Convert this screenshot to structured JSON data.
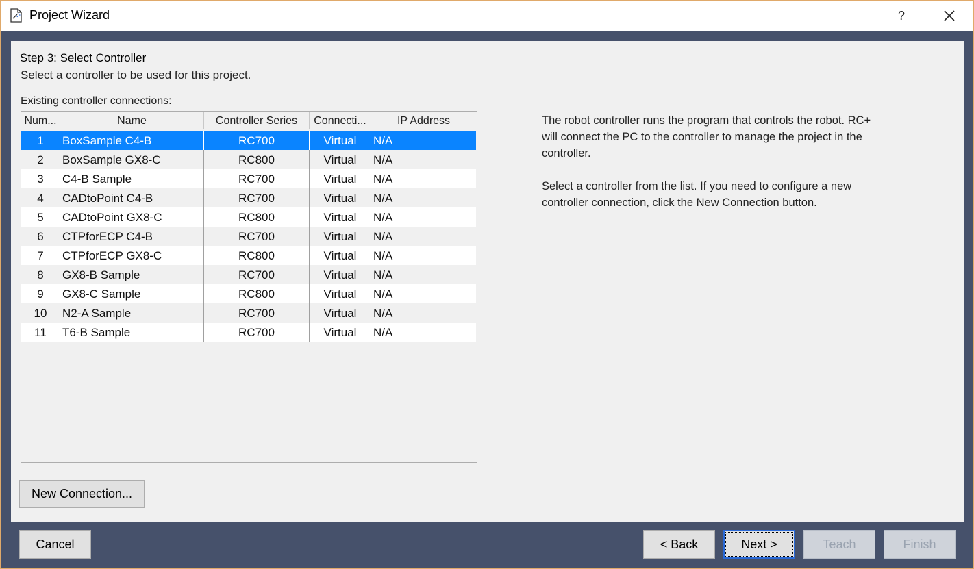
{
  "window": {
    "title": "Project Wizard",
    "help_label": "?"
  },
  "step": {
    "title": "Step 3: Select Controller",
    "subtitle": "Select a controller to be used for this project.",
    "list_label": "Existing controller connections:"
  },
  "table": {
    "columns": [
      "Num...",
      "Name",
      "Controller Series",
      "Connecti...",
      "IP Address"
    ],
    "rows": [
      {
        "num": "1",
        "name": "BoxSample C4-B",
        "series": "RC700",
        "conn": "Virtual",
        "ip": "N/A"
      },
      {
        "num": "2",
        "name": "BoxSample GX8-C",
        "series": "RC800",
        "conn": "Virtual",
        "ip": "N/A"
      },
      {
        "num": "3",
        "name": "C4-B Sample",
        "series": "RC700",
        "conn": "Virtual",
        "ip": "N/A"
      },
      {
        "num": "4",
        "name": "CADtoPoint C4-B",
        "series": "RC700",
        "conn": "Virtual",
        "ip": "N/A"
      },
      {
        "num": "5",
        "name": "CADtoPoint GX8-C",
        "series": "RC800",
        "conn": "Virtual",
        "ip": "N/A"
      },
      {
        "num": "6",
        "name": "CTPforECP C4-B",
        "series": "RC700",
        "conn": "Virtual",
        "ip": "N/A"
      },
      {
        "num": "7",
        "name": "CTPforECP GX8-C",
        "series": "RC800",
        "conn": "Virtual",
        "ip": "N/A"
      },
      {
        "num": "8",
        "name": "GX8-B Sample",
        "series": "RC700",
        "conn": "Virtual",
        "ip": "N/A"
      },
      {
        "num": "9",
        "name": "GX8-C Sample",
        "series": "RC800",
        "conn": "Virtual",
        "ip": "N/A"
      },
      {
        "num": "10",
        "name": "N2-A Sample",
        "series": "RC700",
        "conn": "Virtual",
        "ip": "N/A"
      },
      {
        "num": "11",
        "name": "T6-B Sample",
        "series": "RC700",
        "conn": "Virtual",
        "ip": "N/A"
      }
    ],
    "selected_row": "1"
  },
  "description": {
    "para1_lines": [
      "The robot controller runs the program that controls the robot.  RC+",
      "will connect the PC to the controller to manage the project in the",
      "controller."
    ],
    "para2_lines": [
      "Select a controller from the list.  If you need to configure a new",
      "controller connection, click the New Connection button."
    ]
  },
  "buttons": {
    "new_connection": "New Connection...",
    "cancel": "Cancel",
    "back": "< Back",
    "next": "Next >",
    "teach": "Teach",
    "finish": "Finish"
  },
  "colors": {
    "selection": "#0a84ff",
    "frame_background": "#46516b",
    "window_border": "#e0a96a"
  }
}
